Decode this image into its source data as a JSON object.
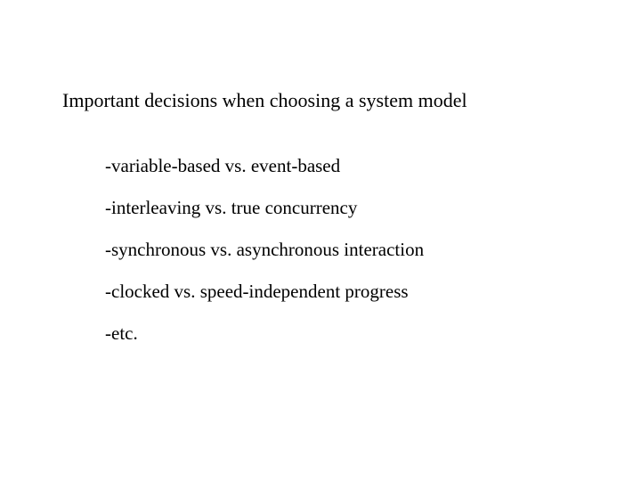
{
  "heading": "Important decisions when choosing a system model",
  "bullets": [
    "-variable-based vs. event-based",
    "-interleaving vs. true concurrency",
    "-synchronous vs. asynchronous interaction",
    "-clocked vs. speed-independent progress",
    "-etc."
  ]
}
